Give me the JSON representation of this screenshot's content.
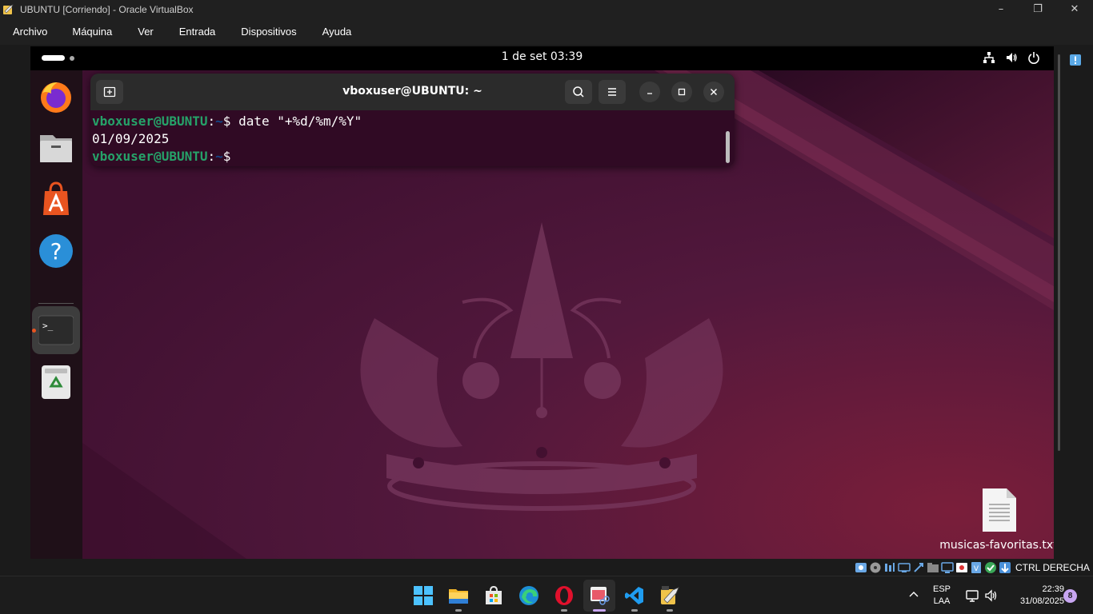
{
  "host_window": {
    "title": "UBUNTU [Corriendo] - Oracle VirtualBox",
    "controls": [
      "–",
      "❐",
      "✕"
    ]
  },
  "menubar": [
    "Archivo",
    "Máquina",
    "Ver",
    "Entrada",
    "Dispositivos",
    "Ayuda"
  ],
  "guest_topbar": {
    "clock": "1 de set  03:39",
    "tray_icons": [
      "network-icon",
      "volume-icon",
      "power-icon"
    ]
  },
  "dock": {
    "apps": [
      "firefox",
      "files",
      "app-center",
      "help",
      "terminal",
      "trash"
    ],
    "running": "terminal"
  },
  "terminal": {
    "title": "vboxuser@UBUNTU: ~",
    "user_host": "vboxuser@UBUNTU",
    "path": "~",
    "lines": [
      {
        "type": "prompt",
        "command": "date \"+%d/%m/%Y\""
      },
      {
        "type": "output",
        "text": "01/09/2025"
      },
      {
        "type": "prompt",
        "command": ""
      }
    ],
    "prompt_symbol": "$"
  },
  "desktop_file": {
    "name": "musicas-favoritas.txt"
  },
  "vbox_status": {
    "host_key": "CTRL DERECHA"
  },
  "taskbar": {
    "apps": [
      "windows-start",
      "file-explorer",
      "microsoft-store",
      "edge",
      "opera",
      "snipping-tool",
      "vscode",
      "virtualbox"
    ],
    "active": "snipping-tool",
    "lang_top": "ESP",
    "lang_bottom": "LAA",
    "time": "22:39",
    "date": "31/08/2025",
    "notifications": "8"
  },
  "colors": {
    "ubuntu_orange": "#e95420",
    "terminal_bg": "#300a24",
    "prompt_green": "#26a269",
    "prompt_blue": "#12488b",
    "wallpaper_purple": "#4a1434"
  }
}
